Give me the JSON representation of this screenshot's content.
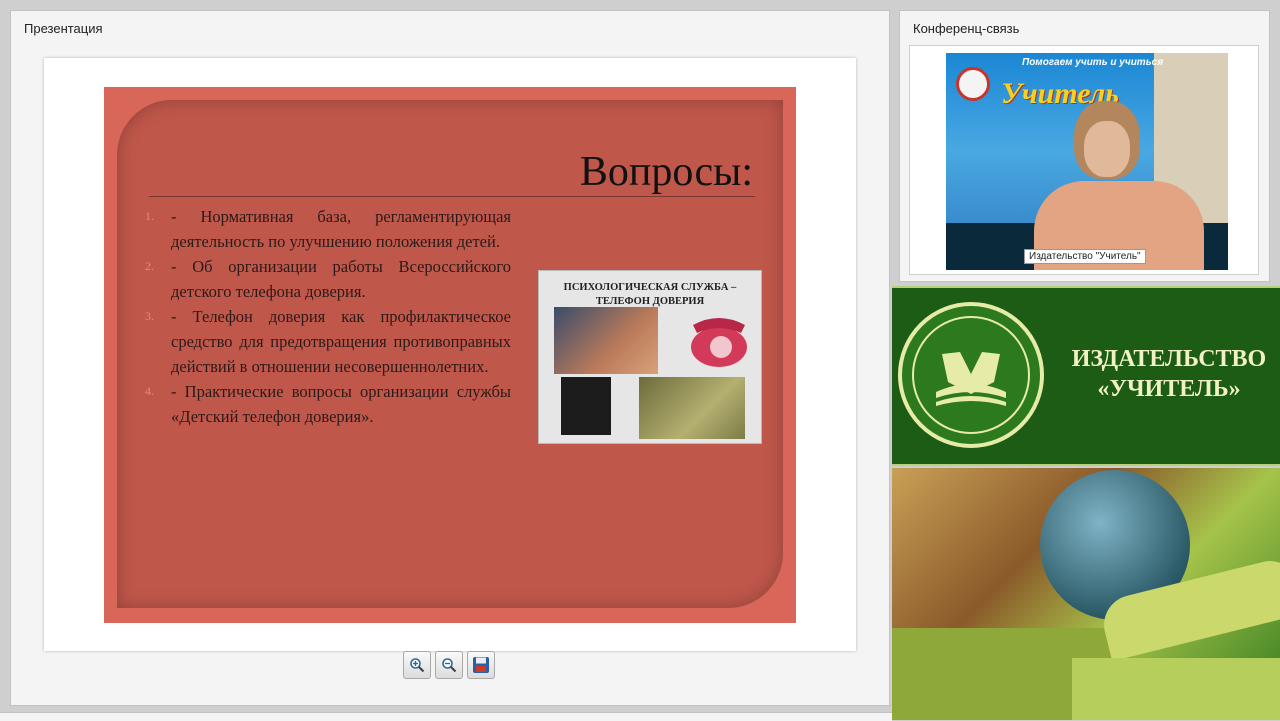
{
  "presentation_pod": {
    "title": "Презентация",
    "slide": {
      "heading": "Вопросы:",
      "items": [
        {
          "num": "1.",
          "text": "- Нормативная база, регламентирующая деятельность по улучшению положения детей."
        },
        {
          "num": "2.",
          "text": "- Об организации работы Всероссийского детского телефона доверия."
        },
        {
          "num": "3.",
          "text": "- Телефон доверия как профилактическое средство для предотвращения противоправных действий в отношении несовершеннолетних."
        },
        {
          "num": "4.",
          "text": "- Практические вопросы организации службы «Детский телефон доверия»."
        }
      ],
      "image_title": "ПСИХОЛОГИЧЕСКАЯ СЛУЖБА – ТЕЛЕФОН ДОВЕРИЯ"
    },
    "toolbar": {
      "zoom_in_icon": "zoom-in-icon",
      "zoom_out_icon": "zoom-out-icon",
      "save_icon": "save-icon"
    }
  },
  "video_pod": {
    "title": "Конференц-связь",
    "caption": "Издательство \"Учитель\"",
    "poster_top_text": "Помогаем учить и учиться",
    "poster_brand": "Учитель"
  },
  "banner": {
    "line1": "ИЗДАТЕЛЬСТВО",
    "line2": "«УЧИТЕЛЬ»"
  },
  "colors": {
    "slide_bg": "#d8675a",
    "slide_inner": "#c0574b",
    "banner_green": "#1c5c15",
    "banner_text": "#f2f0c6"
  }
}
